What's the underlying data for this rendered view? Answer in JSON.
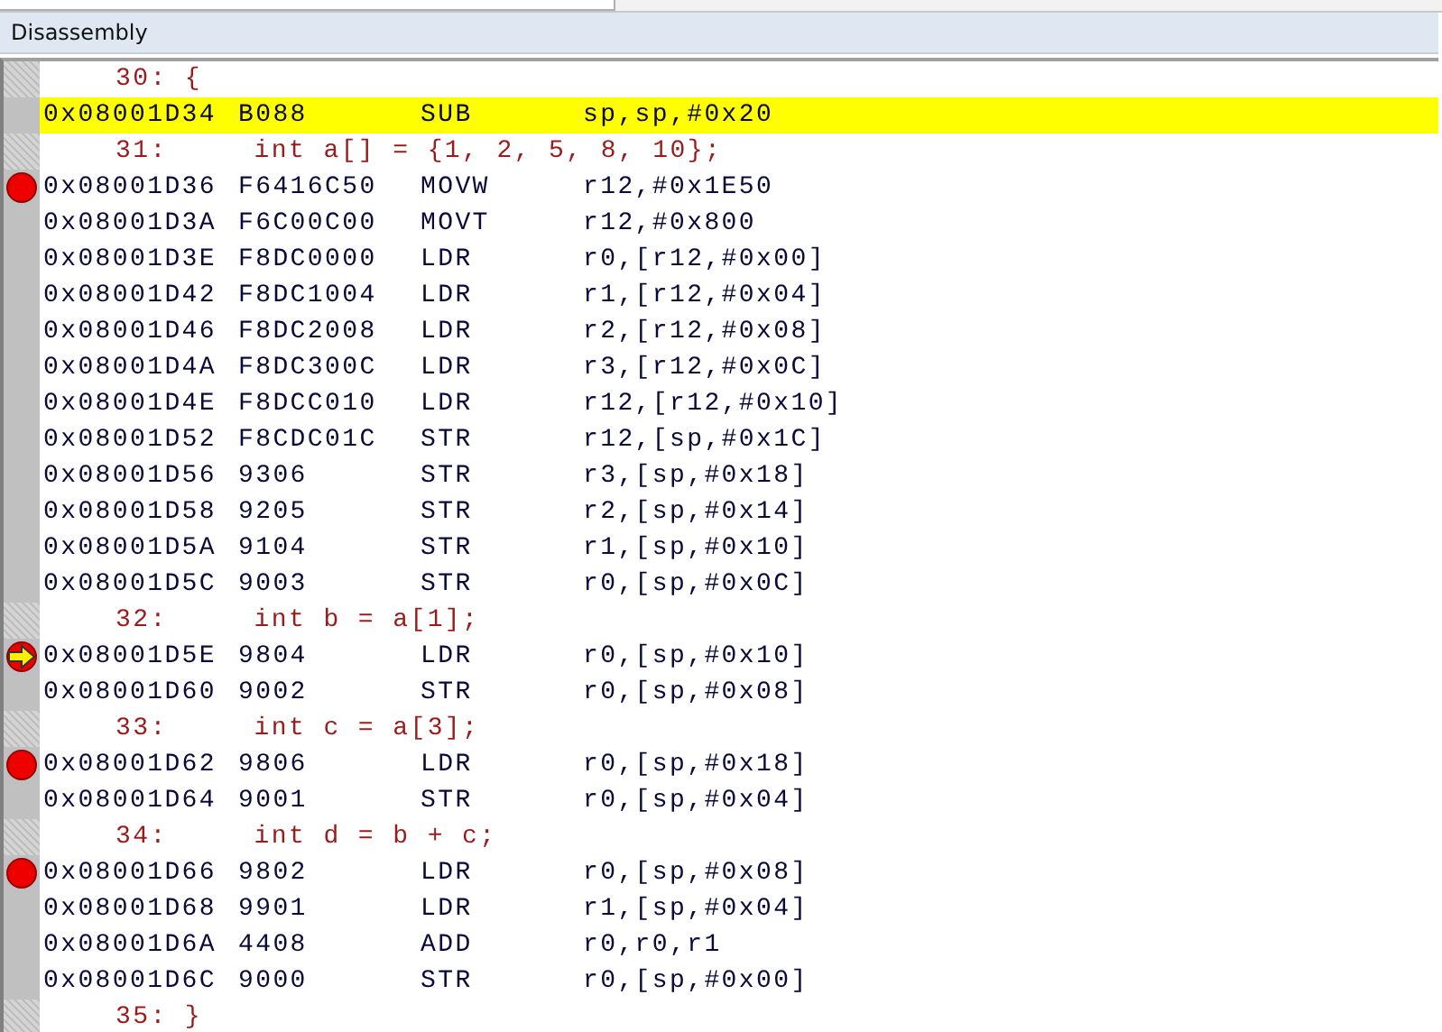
{
  "window": {
    "title": "Disassembly"
  },
  "lines": [
    {
      "kind": "source",
      "text": "30: {"
    },
    {
      "kind": "instruction",
      "address": "0x08001D34",
      "opcode": "B088",
      "mnemonic": "SUB",
      "operands": "sp,sp,#0x20",
      "highlighted": true
    },
    {
      "kind": "source",
      "text": "31:     int a[] = {1, 2, 5, 8, 10};"
    },
    {
      "kind": "instruction",
      "address": "0x08001D36",
      "opcode": "F6416C50",
      "mnemonic": "MOVW",
      "operands": "r12,#0x1E50",
      "highlighted": false,
      "breakpoint": true,
      "current": false
    },
    {
      "kind": "instruction",
      "address": "0x08001D3A",
      "opcode": "F6C00C00",
      "mnemonic": "MOVT",
      "operands": "r12,#0x800",
      "highlighted": false
    },
    {
      "kind": "instruction",
      "address": "0x08001D3E",
      "opcode": "F8DC0000",
      "mnemonic": "LDR",
      "operands": "r0,[r12,#0x00]",
      "highlighted": false
    },
    {
      "kind": "instruction",
      "address": "0x08001D42",
      "opcode": "F8DC1004",
      "mnemonic": "LDR",
      "operands": "r1,[r12,#0x04]",
      "highlighted": false
    },
    {
      "kind": "instruction",
      "address": "0x08001D46",
      "opcode": "F8DC2008",
      "mnemonic": "LDR",
      "operands": "r2,[r12,#0x08]",
      "highlighted": false
    },
    {
      "kind": "instruction",
      "address": "0x08001D4A",
      "opcode": "F8DC300C",
      "mnemonic": "LDR",
      "operands": "r3,[r12,#0x0C]",
      "highlighted": false
    },
    {
      "kind": "instruction",
      "address": "0x08001D4E",
      "opcode": "F8DCC010",
      "mnemonic": "LDR",
      "operands": "r12,[r12,#0x10]",
      "highlighted": false
    },
    {
      "kind": "instruction",
      "address": "0x08001D52",
      "opcode": "F8CDC01C",
      "mnemonic": "STR",
      "operands": "r12,[sp,#0x1C]",
      "highlighted": false
    },
    {
      "kind": "instruction",
      "address": "0x08001D56",
      "opcode": "9306",
      "mnemonic": "STR",
      "operands": "r3,[sp,#0x18]",
      "highlighted": false
    },
    {
      "kind": "instruction",
      "address": "0x08001D58",
      "opcode": "9205",
      "mnemonic": "STR",
      "operands": "r2,[sp,#0x14]",
      "highlighted": false
    },
    {
      "kind": "instruction",
      "address": "0x08001D5A",
      "opcode": "9104",
      "mnemonic": "STR",
      "operands": "r1,[sp,#0x10]",
      "highlighted": false
    },
    {
      "kind": "instruction",
      "address": "0x08001D5C",
      "opcode": "9003",
      "mnemonic": "STR",
      "operands": "r0,[sp,#0x0C]",
      "highlighted": false
    },
    {
      "kind": "source",
      "text": "32:     int b = a[1];"
    },
    {
      "kind": "instruction",
      "address": "0x08001D5E",
      "opcode": "9804",
      "mnemonic": "LDR",
      "operands": "r0,[sp,#0x10]",
      "highlighted": false,
      "breakpoint": true,
      "current": true
    },
    {
      "kind": "instruction",
      "address": "0x08001D60",
      "opcode": "9002",
      "mnemonic": "STR",
      "operands": "r0,[sp,#0x08]",
      "highlighted": false
    },
    {
      "kind": "source",
      "text": "33:     int c = a[3];"
    },
    {
      "kind": "instruction",
      "address": "0x08001D62",
      "opcode": "9806",
      "mnemonic": "LDR",
      "operands": "r0,[sp,#0x18]",
      "highlighted": false,
      "breakpoint": true,
      "current": false
    },
    {
      "kind": "instruction",
      "address": "0x08001D64",
      "opcode": "9001",
      "mnemonic": "STR",
      "operands": "r0,[sp,#0x04]",
      "highlighted": false
    },
    {
      "kind": "source",
      "text": "34:     int d = b + c;"
    },
    {
      "kind": "instruction",
      "address": "0x08001D66",
      "opcode": "9802",
      "mnemonic": "LDR",
      "operands": "r0,[sp,#0x08]",
      "highlighted": false,
      "breakpoint": true,
      "current": false
    },
    {
      "kind": "instruction",
      "address": "0x08001D68",
      "opcode": "9901",
      "mnemonic": "LDR",
      "operands": "r1,[sp,#0x04]",
      "highlighted": false
    },
    {
      "kind": "instruction",
      "address": "0x08001D6A",
      "opcode": "4408",
      "mnemonic": "ADD",
      "operands": "r0,r0,r1",
      "highlighted": false
    },
    {
      "kind": "instruction",
      "address": "0x08001D6C",
      "opcode": "9000",
      "mnemonic": "STR",
      "operands": "r0,[sp,#0x00]",
      "highlighted": false
    },
    {
      "kind": "source",
      "text": "35: }"
    }
  ]
}
